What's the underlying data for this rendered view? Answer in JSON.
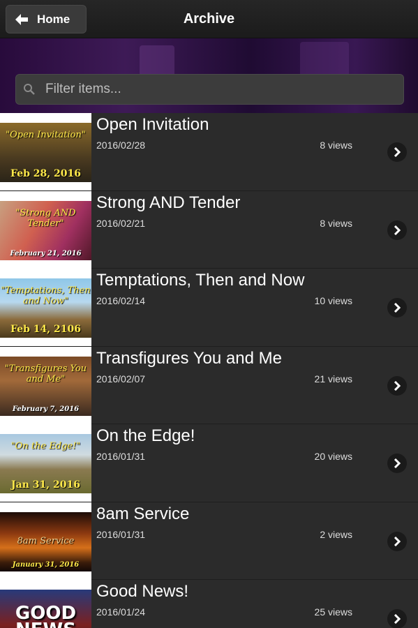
{
  "header": {
    "home_label": "Home",
    "title": "Archive"
  },
  "search": {
    "placeholder": "Filter items..."
  },
  "items": [
    {
      "title": "Open Invitation",
      "date": "2016/02/28",
      "views": "8 views",
      "thumb_caption": "\"Open Invitation\"",
      "thumb_date": "Feb 28, 2016"
    },
    {
      "title": "Strong AND Tender",
      "date": "2016/02/21",
      "views": "8 views",
      "thumb_caption": "\"Strong AND Tender\"",
      "thumb_date": "February 21, 2016"
    },
    {
      "title": "Temptations, Then and Now",
      "date": "2016/02/14",
      "views": "10 views",
      "thumb_caption": "\"Temptations, Then and Now\"",
      "thumb_date": "Feb 14, 2106"
    },
    {
      "title": "Transfigures You and Me",
      "date": "2016/02/07",
      "views": "21 views",
      "thumb_caption": "\"Transfigures You and Me\"",
      "thumb_date": "February 7, 2016"
    },
    {
      "title": "On the Edge!",
      "date": "2016/01/31",
      "views": "20 views",
      "thumb_caption": "\"On the Edge!\"",
      "thumb_date": "Jan 31, 2016"
    },
    {
      "title": "8am Service",
      "date": "2016/01/31",
      "views": "2 views",
      "thumb_caption": "8am Service",
      "thumb_date": "January 31, 2016"
    },
    {
      "title": "Good News!",
      "date": "2016/01/24",
      "views": "25 views",
      "thumb_caption": "GOOD NEWS",
      "thumb_date": ""
    }
  ]
}
